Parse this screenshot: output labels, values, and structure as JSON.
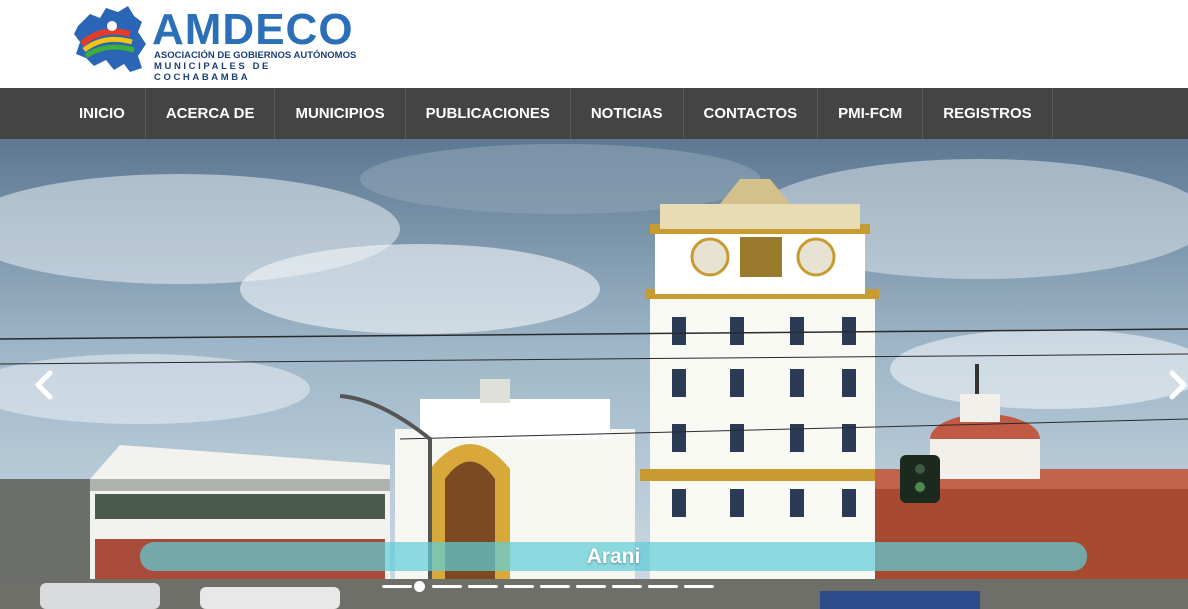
{
  "logo": {
    "title": "AMDECO",
    "subtitle_line1": "ASOCIACIÓN DE GOBIERNOS AUTÓNOMOS",
    "subtitle_line2": "MUNICIPALES DE COCHABAMBA"
  },
  "nav": {
    "items": [
      {
        "label": "INICIO"
      },
      {
        "label": "ACERCA DE"
      },
      {
        "label": "MUNICIPIOS"
      },
      {
        "label": "PUBLICACIONES"
      },
      {
        "label": "NOTICIAS"
      },
      {
        "label": "CONTACTOS"
      },
      {
        "label": "PMI-FCM"
      },
      {
        "label": "REGISTROS"
      }
    ]
  },
  "slider": {
    "caption": "Arani",
    "prev_icon": "chevron-left-icon",
    "next_icon": "chevron-right-icon",
    "slide_count": 9,
    "active_slide": 1
  },
  "colors": {
    "nav_background": "#444444",
    "logo_blue": "#2a6fb8",
    "caption_bar": "#5fcdd7"
  }
}
